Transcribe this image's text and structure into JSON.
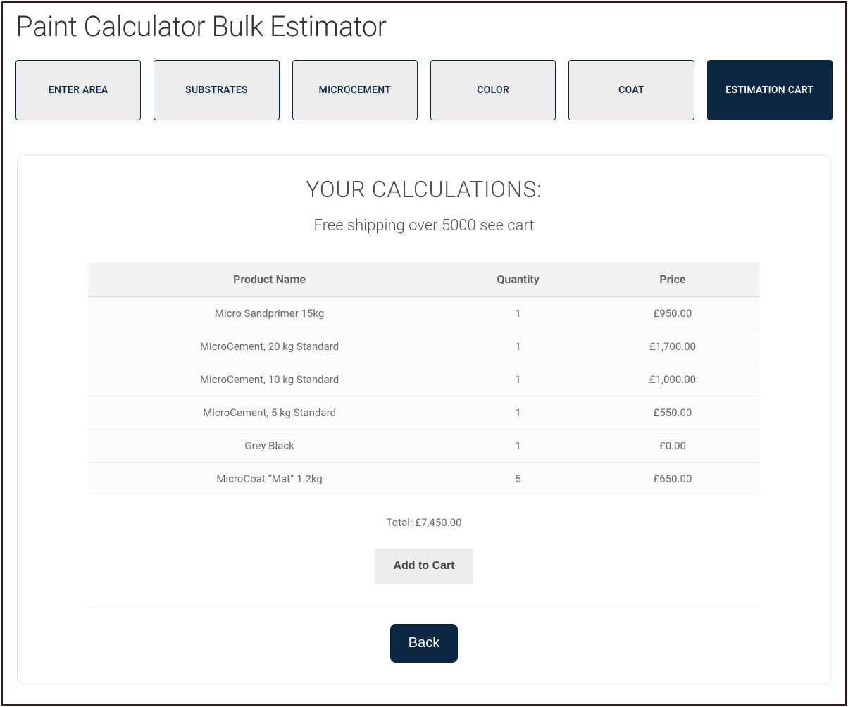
{
  "page": {
    "title": "Paint Calculator Bulk Estimator"
  },
  "tabs": [
    {
      "label": "ENTER AREA",
      "active": false
    },
    {
      "label": "SUBSTRATES",
      "active": false
    },
    {
      "label": "MICROCEMENT",
      "active": false
    },
    {
      "label": "COLOR",
      "active": false
    },
    {
      "label": "COAT",
      "active": false
    },
    {
      "label": "ESTIMATION CART",
      "active": true
    }
  ],
  "calculations": {
    "heading": "YOUR CALCULATIONS:",
    "shipping_note": "Free shipping over 5000 see cart",
    "columns": {
      "product": "Product Name",
      "quantity": "Quantity",
      "price": "Price"
    },
    "rows": [
      {
        "product": "Micro Sandprimer 15kg",
        "quantity": "1",
        "price": "£950.00"
      },
      {
        "product": "MicroCement, 20 kg Standard",
        "quantity": "1",
        "price": "£1,700.00"
      },
      {
        "product": "MicroCement, 10 kg Standard",
        "quantity": "1",
        "price": "£1,000.00"
      },
      {
        "product": "MicroCement, 5 kg Standard",
        "quantity": "1",
        "price": "£550.00"
      },
      {
        "product": "Grey Black",
        "quantity": "1",
        "price": "£0.00"
      },
      {
        "product": "MicroCoat “Mat” 1.2kg",
        "quantity": "5",
        "price": "£650.00"
      }
    ],
    "total_label": "Total: ",
    "total_value": "£7,450.00",
    "add_to_cart_label": "Add to Cart",
    "back_label": "Back"
  }
}
